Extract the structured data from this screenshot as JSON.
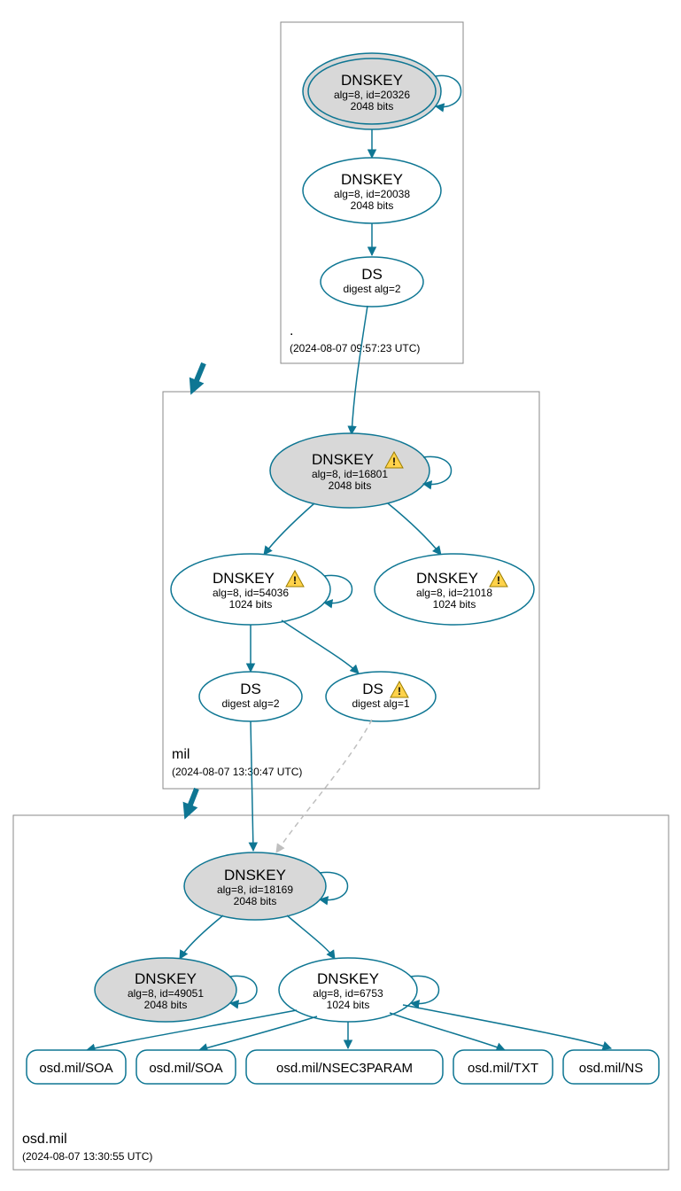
{
  "zones": {
    "root": {
      "name": ".",
      "timestamp": "(2024-08-07 09:57:23 UTC)",
      "nodes": {
        "dnskey_20326": {
          "title": "DNSKEY",
          "alg": "alg=8, id=20326",
          "bits": "2048 bits",
          "warning": false,
          "grey": true,
          "double": true
        },
        "dnskey_20038": {
          "title": "DNSKEY",
          "alg": "alg=8, id=20038",
          "bits": "2048 bits",
          "warning": false,
          "grey": false
        },
        "ds_alg2": {
          "title": "DS",
          "sub": "digest alg=2",
          "warning": false
        }
      }
    },
    "mil": {
      "name": "mil",
      "timestamp": "(2024-08-07 13:30:47 UTC)",
      "nodes": {
        "dnskey_16801": {
          "title": "DNSKEY",
          "alg": "alg=8, id=16801",
          "bits": "2048 bits",
          "warning": true,
          "grey": true
        },
        "dnskey_54036": {
          "title": "DNSKEY",
          "alg": "alg=8, id=54036",
          "bits": "1024 bits",
          "warning": true,
          "grey": false
        },
        "dnskey_21018": {
          "title": "DNSKEY",
          "alg": "alg=8, id=21018",
          "bits": "1024 bits",
          "warning": true,
          "grey": false
        },
        "ds_alg2": {
          "title": "DS",
          "sub": "digest alg=2",
          "warning": false
        },
        "ds_alg1": {
          "title": "DS",
          "sub": "digest alg=1",
          "warning": true
        }
      }
    },
    "osd": {
      "name": "osd.mil",
      "timestamp": "(2024-08-07 13:30:55 UTC)",
      "nodes": {
        "dnskey_18169": {
          "title": "DNSKEY",
          "alg": "alg=8, id=18169",
          "bits": "2048 bits",
          "warning": false,
          "grey": true
        },
        "dnskey_49051": {
          "title": "DNSKEY",
          "alg": "alg=8, id=49051",
          "bits": "2048 bits",
          "warning": false,
          "grey": true
        },
        "dnskey_6753": {
          "title": "DNSKEY",
          "alg": "alg=8, id=6753",
          "bits": "1024 bits",
          "warning": false,
          "grey": false
        }
      },
      "records": {
        "r1": "osd.mil/SOA",
        "r2": "osd.mil/SOA",
        "r3": "osd.mil/NSEC3PARAM",
        "r4": "osd.mil/TXT",
        "r5": "osd.mil/NS"
      }
    }
  }
}
